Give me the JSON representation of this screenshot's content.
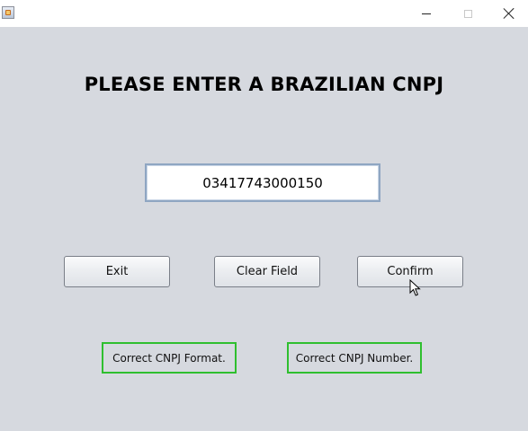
{
  "window": {
    "app_icon": "java-cup-icon",
    "controls": {
      "minimize": "minimize-icon",
      "maximize": "maximize-icon",
      "close": "close-icon"
    }
  },
  "main": {
    "heading": "PLEASE ENTER A BRAZILIAN CNPJ",
    "cnpj_input": {
      "value": "03417743000150",
      "placeholder": ""
    },
    "buttons": {
      "exit": "Exit",
      "clear": "Clear Field",
      "confirm": "Confirm"
    },
    "status": {
      "format": "Correct CNPJ Format.",
      "number": "Correct CNPJ Number."
    }
  },
  "colors": {
    "background": "#d6d9df",
    "status_border": "#2fbf2f",
    "input_border": "#8fa6c2"
  }
}
